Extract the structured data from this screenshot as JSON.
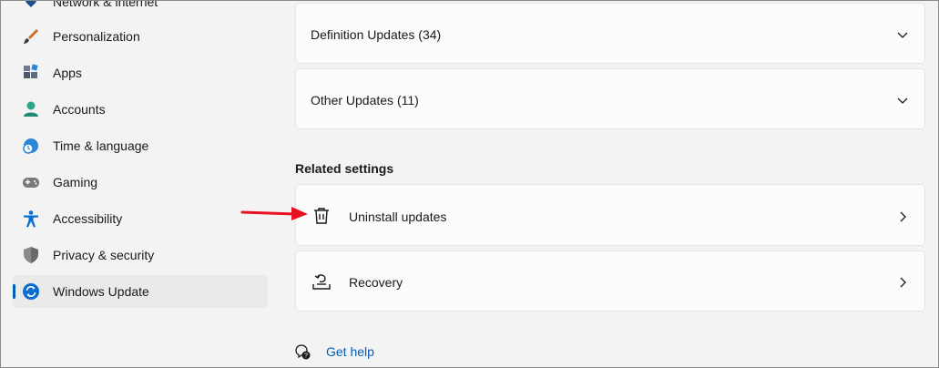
{
  "sidebar": {
    "items": [
      {
        "label": "Network & internet",
        "icon": "network-icon"
      },
      {
        "label": "Personalization",
        "icon": "brush-icon"
      },
      {
        "label": "Apps",
        "icon": "apps-icon"
      },
      {
        "label": "Accounts",
        "icon": "person-icon"
      },
      {
        "label": "Time & language",
        "icon": "globe-clock-icon"
      },
      {
        "label": "Gaming",
        "icon": "gamepad-icon"
      },
      {
        "label": "Accessibility",
        "icon": "accessibility-icon"
      },
      {
        "label": "Privacy & security",
        "icon": "shield-icon"
      },
      {
        "label": "Windows Update",
        "icon": "update-icon",
        "active": true
      }
    ]
  },
  "main": {
    "collapsibles": [
      {
        "label": "Definition Updates (34)",
        "icon": "chevron-down-icon"
      },
      {
        "label": "Other Updates (11)",
        "icon": "chevron-down-icon"
      }
    ],
    "related_settings_title": "Related settings",
    "related": [
      {
        "label": "Uninstall updates",
        "icon": "trash-icon"
      },
      {
        "label": "Recovery",
        "icon": "recovery-icon"
      }
    ],
    "help_label": "Get help",
    "help_icon": "help-chat-icon"
  },
  "colors": {
    "accent": "#005fb8",
    "annotation_arrow": "#e81123",
    "background": "#f3f3f3",
    "card": "#fbfbfb"
  }
}
